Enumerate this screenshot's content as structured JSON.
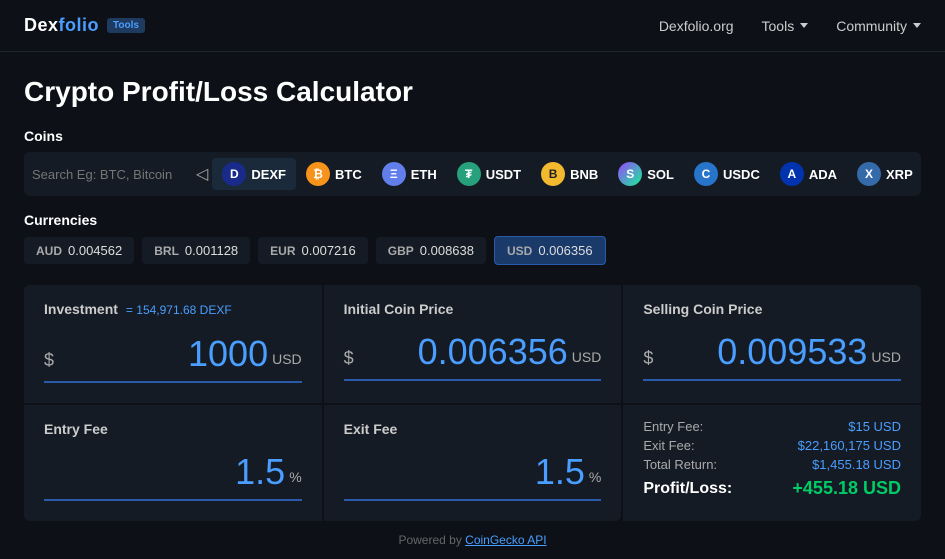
{
  "header": {
    "logo": "Dexfolio",
    "logo_highlight": "folio",
    "tools_badge": "Tools",
    "nav": [
      {
        "label": "Dexfolio.org",
        "has_dropdown": false
      },
      {
        "label": "Tools",
        "has_dropdown": true
      },
      {
        "label": "Community",
        "has_dropdown": true
      }
    ]
  },
  "page": {
    "title": "Crypto Profit/Loss Calculator"
  },
  "coins": {
    "section_label": "Coins",
    "search_placeholder": "Search Eg: BTC, Bitcoin, etc.",
    "items": [
      {
        "symbol": "DEXF",
        "icon_class": "icon-dexf",
        "icon_char": "D"
      },
      {
        "symbol": "BTC",
        "icon_class": "icon-btc",
        "icon_char": "₿"
      },
      {
        "symbol": "ETH",
        "icon_class": "icon-eth",
        "icon_char": "Ξ"
      },
      {
        "symbol": "USDT",
        "icon_class": "icon-usdt",
        "icon_char": "₮"
      },
      {
        "symbol": "BNB",
        "icon_class": "icon-bnb",
        "icon_char": "B"
      },
      {
        "symbol": "SOL",
        "icon_class": "icon-sol",
        "icon_char": "S"
      },
      {
        "symbol": "USDC",
        "icon_class": "icon-usdc",
        "icon_char": "C"
      },
      {
        "symbol": "ADA",
        "icon_class": "icon-ada",
        "icon_char": "A"
      },
      {
        "symbol": "XRP",
        "icon_class": "icon-xrp",
        "icon_char": "X"
      }
    ]
  },
  "currencies": {
    "section_label": "Currencies",
    "items": [
      {
        "code": "AUD",
        "value": "0.004562",
        "active": false
      },
      {
        "code": "BRL",
        "value": "0.001128",
        "active": false
      },
      {
        "code": "EUR",
        "value": "0.007216",
        "active": false
      },
      {
        "code": "GBP",
        "value": "0.008638",
        "active": false
      },
      {
        "code": "USD",
        "value": "0.006356",
        "active": true
      }
    ]
  },
  "calculator": {
    "investment": {
      "title": "Investment",
      "subtitle": "= 154,971.68 DEXF",
      "currency_symbol": "$",
      "value": "1000",
      "unit": "USD"
    },
    "initial_coin_price": {
      "title": "Initial Coin Price",
      "currency_symbol": "$",
      "value": "0.006356",
      "unit": "USD"
    },
    "selling_coin_price": {
      "title": "Selling Coin Price",
      "currency_symbol": "$",
      "value": "0.009533",
      "unit": "USD"
    },
    "entry_fee": {
      "title": "Entry Fee",
      "value": "1.5",
      "unit": "%"
    },
    "exit_fee": {
      "title": "Exit Fee",
      "value": "1.5",
      "unit": "%"
    },
    "results": {
      "entry_fee_label": "Entry Fee:",
      "entry_fee_value": "$15 USD",
      "exit_fee_label": "Exit Fee:",
      "exit_fee_value": "$22,160,175 USD",
      "total_return_label": "Total Return:",
      "total_return_value": "$1,455.18 USD",
      "profit_loss_label": "Profit/Loss:",
      "profit_loss_value": "+455.18 USD"
    }
  },
  "footer": {
    "text": "Powered by ",
    "link_text": "CoinGecko API"
  }
}
